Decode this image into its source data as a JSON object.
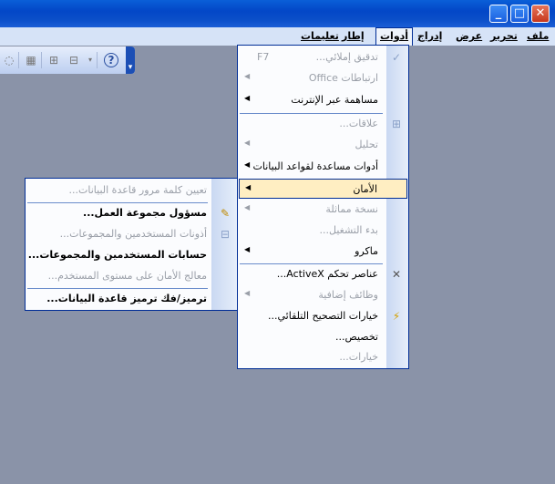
{
  "window": {
    "minimize_glyph": "_",
    "maximize_glyph": "□",
    "close_glyph": "✕"
  },
  "menubar": [
    {
      "key": "file",
      "label": "ملف"
    },
    {
      "key": "edit",
      "label": "تحرير"
    },
    {
      "key": "view",
      "label": "عرض"
    },
    {
      "key": "insert",
      "label": "إدراج"
    },
    {
      "key": "tools",
      "label": "أدوات"
    },
    {
      "key": "window",
      "label": "إطار"
    },
    {
      "key": "help",
      "label": "تعليمات"
    }
  ],
  "toolbar": {
    "icons": [
      "relationships-icon",
      "analyze-icon",
      "office-links-icon",
      "help-icon"
    ]
  },
  "tools_menu": {
    "items": [
      {
        "label": "تدقيق إملائي...",
        "shortcut": "F7",
        "disabled": true,
        "icon": "spelling-icon"
      },
      {
        "label": "ارتباطات Office",
        "disabled": true,
        "submenu": true
      },
      {
        "label": "مساهمة عبر الإنترنت",
        "disabled": false,
        "submenu": true
      },
      {
        "label": "علاقات...",
        "disabled": true,
        "icon": "relationships-icon"
      },
      {
        "label": "تحليل",
        "disabled": true,
        "submenu": true
      },
      {
        "label": "أدوات مساعدة لقواعد البيانات",
        "disabled": false,
        "submenu": true
      },
      {
        "label": "الأمان",
        "disabled": false,
        "submenu": true,
        "highlighted": true
      },
      {
        "label": "نسخة مماثلة",
        "disabled": true,
        "submenu": true
      },
      {
        "label": "بدء التشغيل...",
        "disabled": true
      },
      {
        "label": "ماكرو",
        "disabled": false,
        "submenu": true
      },
      {
        "label": "عناصر تحكم ActiveX...",
        "disabled": false,
        "icon": "activex-icon"
      },
      {
        "label": "وظائف إضافية",
        "disabled": true,
        "submenu": true
      },
      {
        "label": "خيارات التصحيح التلقائي...",
        "disabled": false,
        "icon": "autocorrect-icon"
      },
      {
        "label": "تخصيص...",
        "disabled": false
      },
      {
        "label": "خيارات...",
        "disabled": true
      }
    ]
  },
  "security_submenu": {
    "items": [
      {
        "label": "تعيين كلمة مرور قاعدة البيانات...",
        "disabled": true
      },
      {
        "label": "مسؤول مجموعة العمل...",
        "disabled": false,
        "icon": "workgroup-admin-icon"
      },
      {
        "label": "أذونات المستخدمين والمجموعات...",
        "disabled": true,
        "icon": "permissions-icon"
      },
      {
        "label": "حسابات المستخدمين والمجموعات...",
        "disabled": false
      },
      {
        "label": "معالج الأمان على مستوى المستخدم...",
        "disabled": true
      },
      {
        "label": "ترميز/فك ترميز قاعدة البيانات...",
        "disabled": false
      }
    ]
  }
}
